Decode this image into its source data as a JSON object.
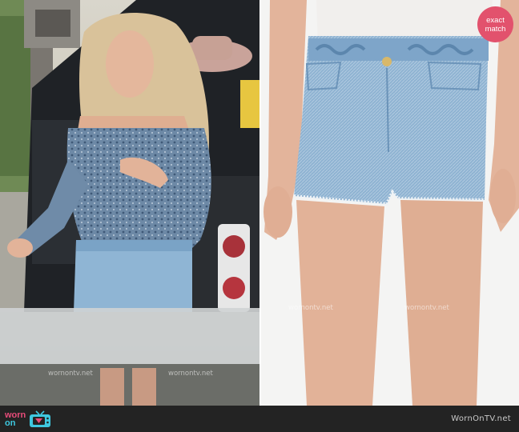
{
  "badge": {
    "line1": "exact",
    "line2": "match",
    "color": "#e2526d"
  },
  "watermark_text": "wornontv.net",
  "footer": {
    "logo_top": "worn",
    "logo_bottom": "on",
    "logo_colors": {
      "pink": "#e84c7a",
      "cyan": "#3ec8e0"
    },
    "site_name": "WornOnTV.net",
    "background": "#232323"
  },
  "icons": {
    "logo": "tv-icon"
  }
}
